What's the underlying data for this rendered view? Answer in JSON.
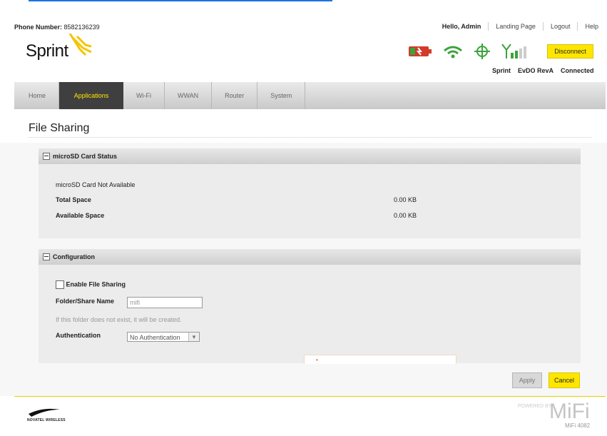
{
  "header": {
    "phone_label": "Phone Number:",
    "phone_number": "8582136239",
    "greeting": "Hello, Admin",
    "links": [
      "Landing Page",
      "Logout",
      "Help"
    ],
    "logo_text": "Sprint",
    "disconnect_label": "Disconnect",
    "status": [
      "Sprint",
      "EvDO RevA",
      "Connected"
    ]
  },
  "nav": {
    "tabs": [
      "Home",
      "Applications",
      "Wi-Fi",
      "WWAN",
      "Router",
      "System"
    ],
    "active": "Applications"
  },
  "page": {
    "title": "File Sharing"
  },
  "sd_status": {
    "heading": "microSD Card Status",
    "message": "microSD Card Not Available",
    "total_label": "Total Space",
    "total_value": "0.00 KB",
    "available_label": "Available Space",
    "available_value": "0.00 KB"
  },
  "configuration": {
    "heading": "Configuration",
    "enable_label": "Enable File Sharing",
    "folder_label": "Folder/Share Name",
    "folder_placeholder": "mifi",
    "folder_help": "If this folder does not exist, it will be created.",
    "auth_label": "Authentication",
    "auth_value": "No Authentication"
  },
  "actions": {
    "apply": "Apply",
    "cancel": "Cancel"
  },
  "footer": {
    "brand": "NOVATEL WIRELESS",
    "powered": "POWERED BY",
    "mifi": "MiFi",
    "model": "MiFi 4082"
  },
  "colors": {
    "accent": "#ffe600",
    "nav_active": "#3f3f3f",
    "wifi_green": "#3aa33a",
    "battery_red": "#d23a2a"
  }
}
